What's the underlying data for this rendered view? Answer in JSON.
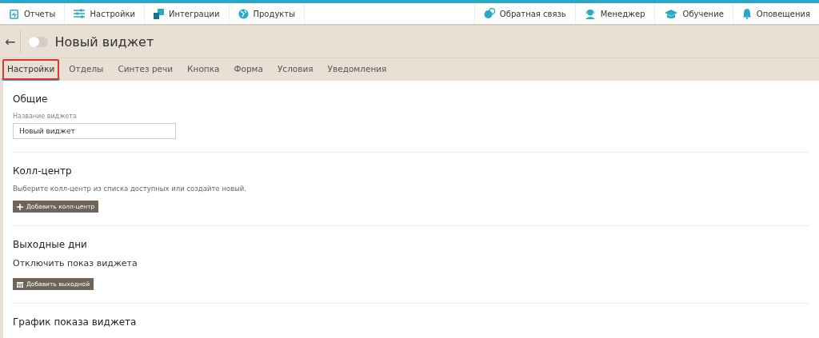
{
  "nav_left": [
    {
      "label": "Отчеты"
    },
    {
      "label": "Настройки"
    },
    {
      "label": "Интеграции"
    },
    {
      "label": "Продукты"
    }
  ],
  "nav_right": [
    {
      "label": "Обратная связь"
    },
    {
      "label": "Менеджер"
    },
    {
      "label": "Обучение"
    },
    {
      "label": "Оповещения"
    }
  ],
  "header": {
    "back": "←",
    "toggle_on": false,
    "title": "Новый виджет"
  },
  "tabs": [
    {
      "label": "Настройки",
      "selected": true
    },
    {
      "label": "Отделы",
      "selected": false
    },
    {
      "label": "Синтез речи",
      "selected": false
    },
    {
      "label": "Кнопка",
      "selected": false
    },
    {
      "label": "Форма",
      "selected": false
    },
    {
      "label": "Условия",
      "selected": false
    },
    {
      "label": "Уведомления",
      "selected": false
    }
  ],
  "sections": [
    {
      "title": "Общие",
      "items": [
        {
          "kind": "label",
          "text": "Название виджета"
        },
        {
          "kind": "field",
          "text": "Новый виджет"
        }
      ]
    },
    {
      "title": "Колл-центр",
      "items": [
        {
          "kind": "text",
          "text": "Выберите колл-центр из списка доступных или создайте новый."
        },
        {
          "kind": "add_button",
          "text": "Добавить колл-центр"
        }
      ]
    },
    {
      "title": "Выходные дни",
      "items": [
        {
          "kind": "subtitle",
          "text": "Отключить показ виджета"
        },
        {
          "kind": "date_button",
          "text": "Добавить выходной"
        }
      ]
    },
    {
      "title": "График показа виджета"
    }
  ]
}
